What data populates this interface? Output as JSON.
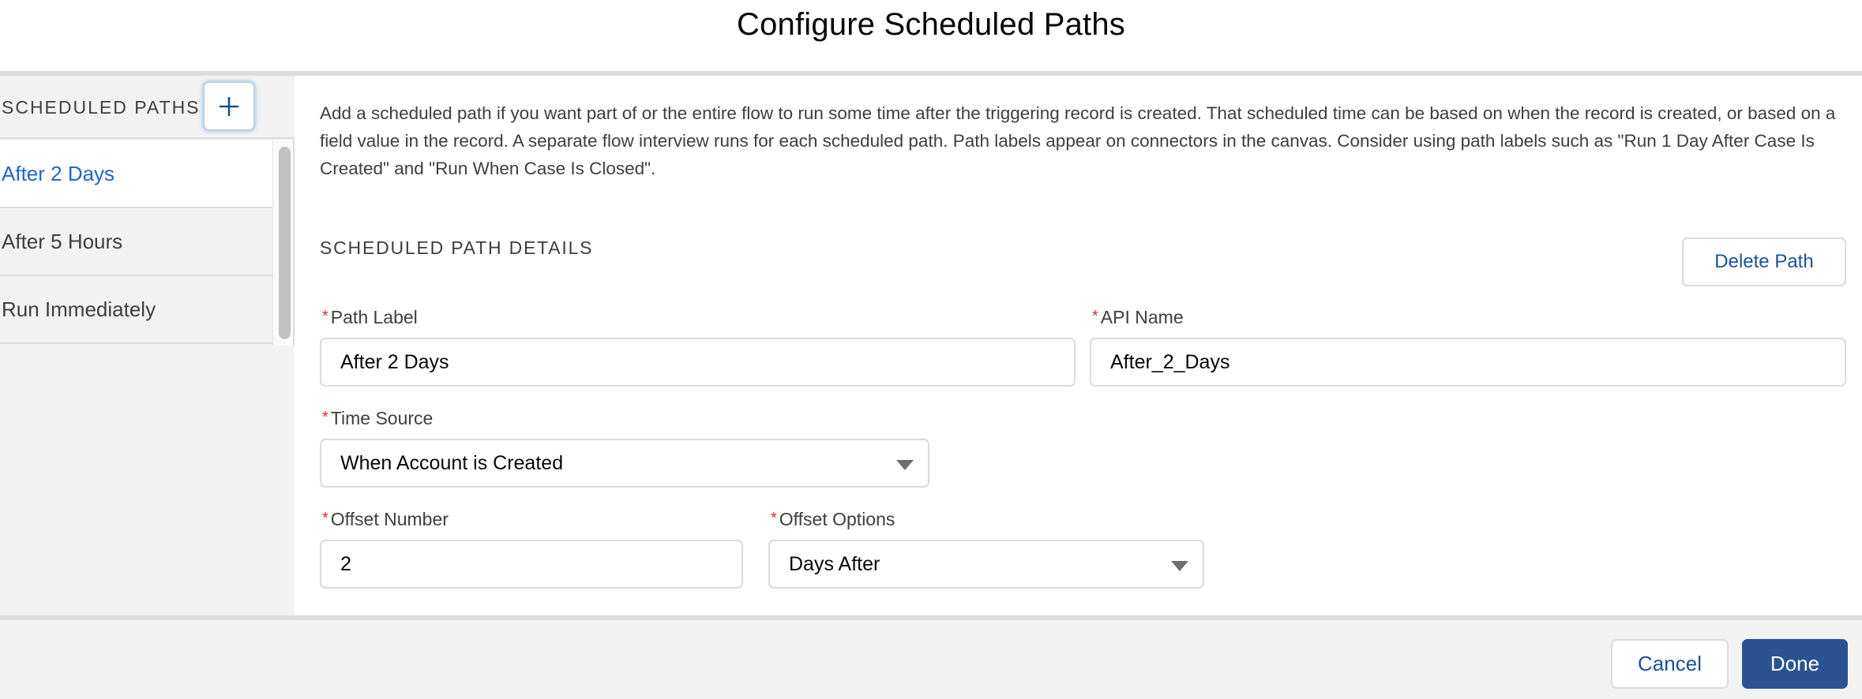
{
  "modal": {
    "title": "Configure Scheduled Paths"
  },
  "sidebar": {
    "title": "SCHEDULED PATHS",
    "add_button_icon": "plus-icon",
    "items": [
      {
        "label": "After 2 Days",
        "active": true
      },
      {
        "label": "After 5 Hours",
        "active": false
      },
      {
        "label": "Run Immediately",
        "active": false
      }
    ]
  },
  "main": {
    "intro": "Add a scheduled path if you want part of or the entire flow to run some time after the triggering record is created. That scheduled time can be based on when the record is created, or based on a field value in the record. A separate flow interview runs for each scheduled path. Path labels appear on connectors in the canvas. Consider using path labels such as \"Run 1 Day After Case Is Created\" and \"Run When Case Is Closed\".",
    "section_title": "SCHEDULED PATH DETAILS",
    "delete_label": "Delete Path",
    "fields": {
      "path_label": {
        "label": "Path Label",
        "required": "*",
        "value": "After 2 Days"
      },
      "api_name": {
        "label": "API Name",
        "required": "*",
        "value": "After_2_Days"
      },
      "time_source": {
        "label": "Time Source",
        "required": "*",
        "value": "When Account is Created"
      },
      "offset_number": {
        "label": "Offset Number",
        "required": "*",
        "value": "2"
      },
      "offset_options": {
        "label": "Offset Options",
        "required": "*",
        "value": "Days After"
      }
    }
  },
  "footer": {
    "cancel_label": "Cancel",
    "done_label": "Done"
  },
  "colors": {
    "accent": "#1b6ac9",
    "brand_button": "#2b5393",
    "link_text": "#1b5297",
    "required": "#c23934"
  }
}
